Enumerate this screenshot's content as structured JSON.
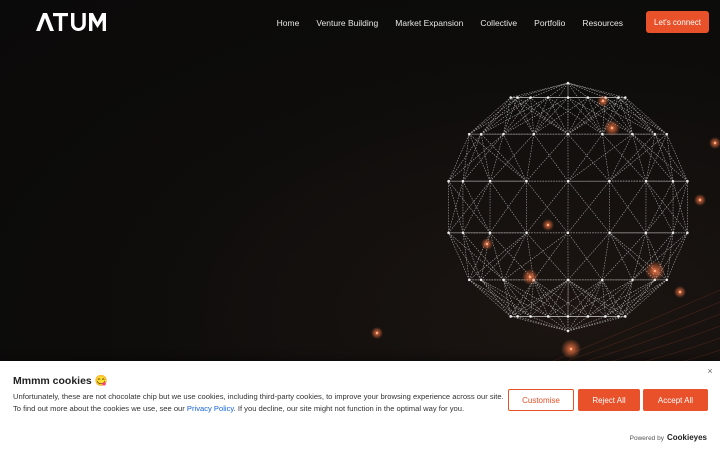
{
  "header": {
    "logo_text": "ATUM",
    "nav": [
      {
        "label": "Home"
      },
      {
        "label": "Venture Building"
      },
      {
        "label": "Market Expansion"
      },
      {
        "label": "Collective"
      },
      {
        "label": "Portfolio"
      },
      {
        "label": "Resources"
      }
    ],
    "cta_label": "Let's connect"
  },
  "cookie_banner": {
    "title": "Mmmm cookies 😋",
    "text_before_link": "Unfortunately, these are not chocolate chip but we use cookies, including third-party cookies, to improve your browsing experience across our site. To find out more about the cookies we use, see our ",
    "link_text": "Privacy Policy",
    "text_after_link": ". If you decline, our site might not function in the optimal way for you.",
    "close_symbol": "×",
    "buttons": {
      "customise": "Customise",
      "reject": "Reject All",
      "accept": "Accept All"
    },
    "powered_by": "Powered by",
    "powered_brand": "Cookieyes"
  },
  "colors": {
    "accent": "#e8512a",
    "background": "#0e0d0c",
    "link": "#1863dc"
  },
  "icons": {
    "close": "close-icon",
    "logo": "atum-logo"
  }
}
